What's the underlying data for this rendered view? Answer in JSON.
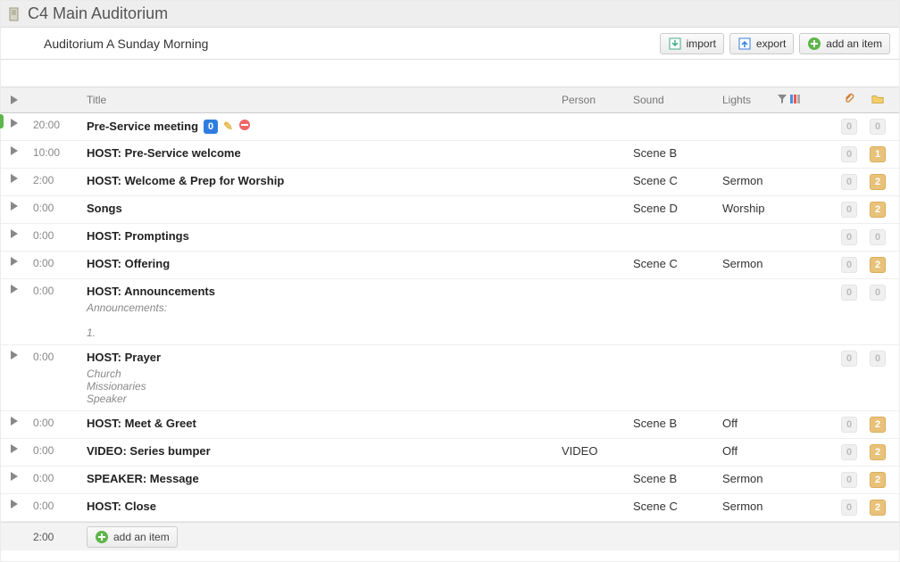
{
  "page_title": "C4 Main Auditorium",
  "service_name": "Auditorium A Sunday Morning",
  "actions": {
    "import": "import",
    "export": "export",
    "add_item": "add an item"
  },
  "columns": {
    "title": "Title",
    "person": "Person",
    "sound": "Sound",
    "lights": "Lights"
  },
  "footer": {
    "total_time": "2:00",
    "add_item": "add an item"
  },
  "rows": [
    {
      "time": "20:00",
      "title": "Pre-Service meeting",
      "badge": "0",
      "editable": true,
      "person": "",
      "sound": "",
      "lights": "",
      "c1": {
        "v": "0",
        "style": "gray"
      },
      "c2": {
        "v": "0",
        "style": "gray"
      }
    },
    {
      "time": "10:00",
      "title": "HOST: Pre-Service welcome",
      "person": "",
      "sound": "Scene B",
      "lights": "",
      "c1": {
        "v": "0",
        "style": "gray"
      },
      "c2": {
        "v": "1",
        "style": "amber"
      }
    },
    {
      "time": "2:00",
      "title": "HOST: Welcome & Prep for Worship",
      "person": "",
      "sound": "Scene C",
      "lights": "Sermon",
      "c1": {
        "v": "0",
        "style": "gray"
      },
      "c2": {
        "v": "2",
        "style": "amber"
      }
    },
    {
      "time": "0:00",
      "title": "Songs",
      "person": "",
      "sound": "Scene D",
      "lights": "Worship",
      "c1": {
        "v": "0",
        "style": "gray"
      },
      "c2": {
        "v": "2",
        "style": "amber"
      }
    },
    {
      "time": "0:00",
      "title": "HOST: Promptings",
      "person": "",
      "sound": "",
      "lights": "",
      "c1": {
        "v": "0",
        "style": "gray"
      },
      "c2": {
        "v": "0",
        "style": "gray"
      }
    },
    {
      "time": "0:00",
      "title": "HOST: Offering",
      "person": "",
      "sound": "Scene C",
      "lights": "Sermon",
      "c1": {
        "v": "0",
        "style": "gray"
      },
      "c2": {
        "v": "2",
        "style": "amber"
      }
    },
    {
      "time": "0:00",
      "title": "HOST: Announcements",
      "sub": "Announcements:\n\n1.",
      "person": "",
      "sound": "",
      "lights": "",
      "c1": {
        "v": "0",
        "style": "gray"
      },
      "c2": {
        "v": "0",
        "style": "gray"
      }
    },
    {
      "time": "0:00",
      "title": "HOST: Prayer",
      "sub": "Church\nMissionaries\nSpeaker",
      "person": "",
      "sound": "",
      "lights": "",
      "c1": {
        "v": "0",
        "style": "gray"
      },
      "c2": {
        "v": "0",
        "style": "gray"
      }
    },
    {
      "time": "0:00",
      "title": "HOST: Meet & Greet",
      "person": "",
      "sound": "Scene B",
      "lights": "Off",
      "c1": {
        "v": "0",
        "style": "gray"
      },
      "c2": {
        "v": "2",
        "style": "amber"
      }
    },
    {
      "time": "0:00",
      "title": "VIDEO: Series bumper",
      "person": "VIDEO",
      "sound": "",
      "lights": "Off",
      "c1": {
        "v": "0",
        "style": "gray"
      },
      "c2": {
        "v": "2",
        "style": "amber"
      }
    },
    {
      "time": "0:00",
      "title": "SPEAKER: Message",
      "person": "",
      "sound": "Scene B",
      "lights": "Sermon",
      "c1": {
        "v": "0",
        "style": "gray"
      },
      "c2": {
        "v": "2",
        "style": "amber"
      }
    },
    {
      "time": "0:00",
      "title": "HOST: Close",
      "person": "",
      "sound": "Scene C",
      "lights": "Sermon",
      "c1": {
        "v": "0",
        "style": "gray"
      },
      "c2": {
        "v": "2",
        "style": "amber"
      }
    }
  ]
}
